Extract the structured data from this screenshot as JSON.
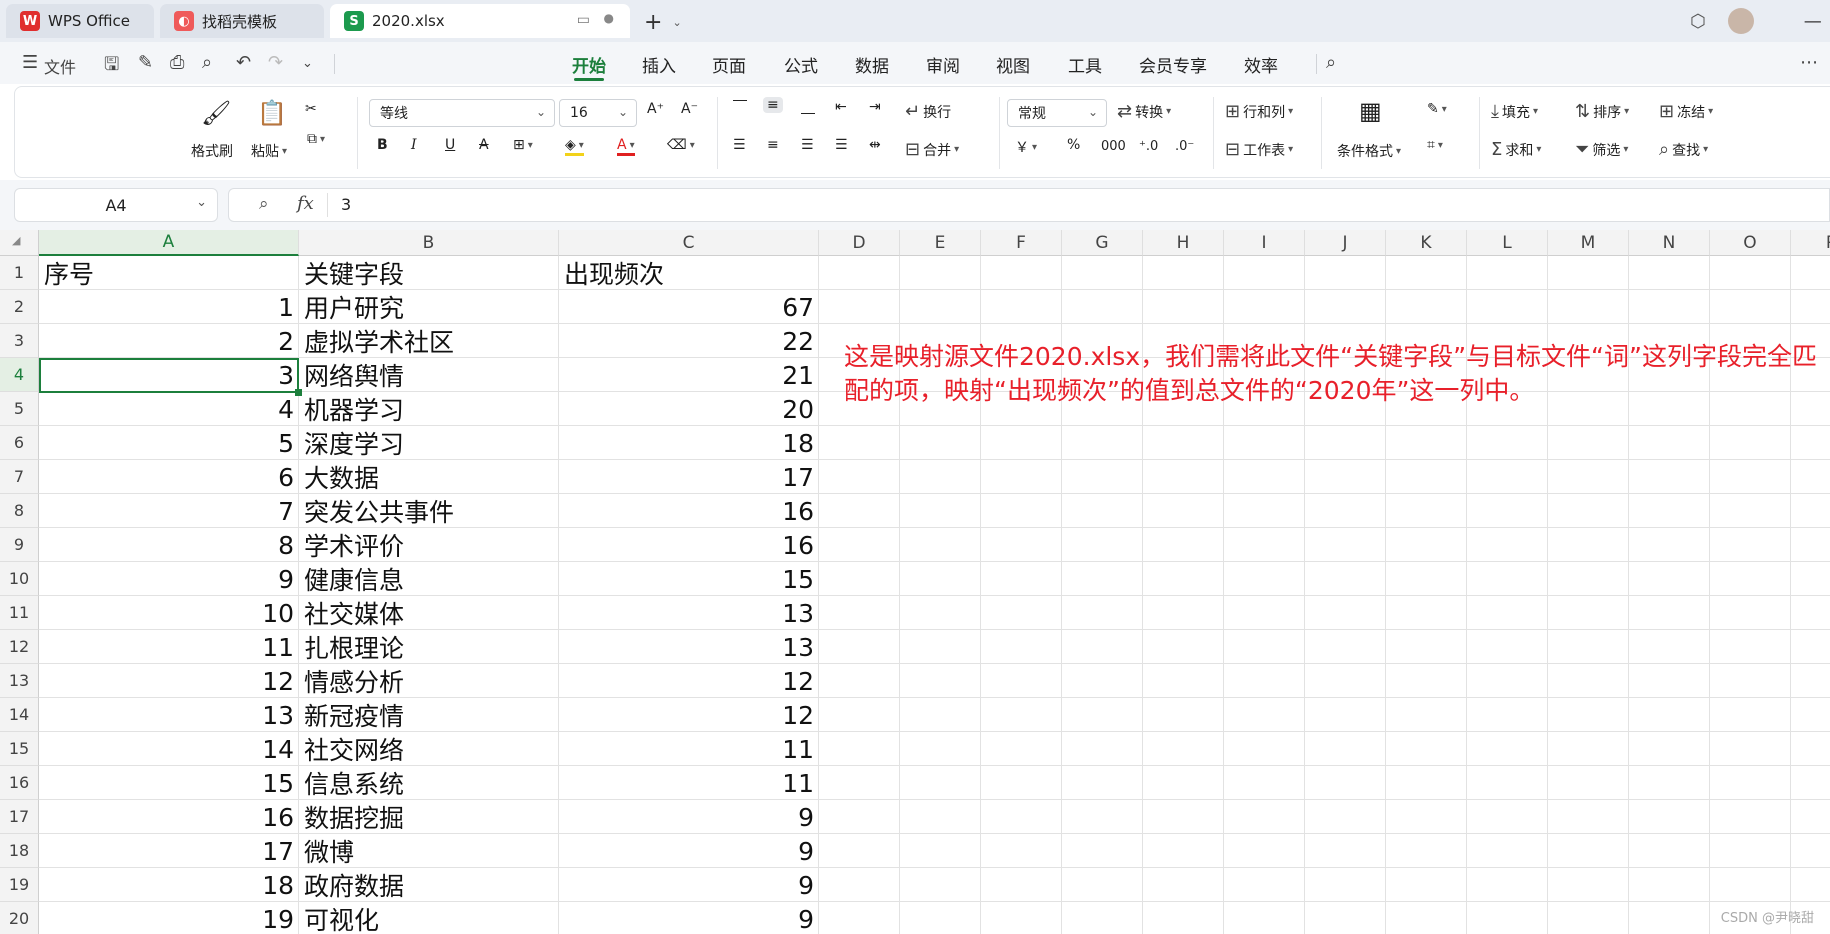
{
  "tabs": [
    {
      "label": "WPS Office",
      "icon": "wps-logo-icon",
      "active": false
    },
    {
      "label": "找稻壳模板",
      "icon": "docer-logo-icon",
      "active": false
    },
    {
      "label": "2020.xlsx",
      "icon": "spreadsheet-file-icon",
      "active": true
    }
  ],
  "menubar": {
    "file_label": "文件",
    "items": [
      "开始",
      "插入",
      "页面",
      "公式",
      "数据",
      "审阅",
      "视图",
      "工具",
      "会员专享",
      "效率"
    ],
    "active": "开始"
  },
  "ribbon": {
    "format_painter": "格式刷",
    "paste": "粘贴",
    "font_name": "等线",
    "font_size": "16",
    "wrap_text": "换行",
    "merge": "合并",
    "number_format": "常规",
    "convert": "转换",
    "rows_cols": "行和列",
    "worksheet": "工作表",
    "conditional_format": "条件格式",
    "fill": "填充",
    "sort": "排序",
    "freeze": "冻结",
    "sum": "求和",
    "filter": "筛选",
    "find": "查找",
    "currency_symbol": "￥",
    "percent_symbol": "%"
  },
  "formula_bar": {
    "name_box": "A4",
    "fx_label": "fx",
    "value": "3"
  },
  "grid": {
    "columns": [
      "A",
      "B",
      "C",
      "D",
      "E",
      "F",
      "G",
      "H",
      "I",
      "J",
      "K",
      "L",
      "M",
      "N",
      "O",
      "P"
    ],
    "selected_column": "A",
    "selected_row": 4,
    "row_numbers": [
      "1",
      "2",
      "3",
      "4",
      "5",
      "6",
      "7",
      "8",
      "9",
      "10",
      "11",
      "12",
      "13",
      "14",
      "15",
      "16",
      "17",
      "18",
      "19",
      "20"
    ],
    "header_row": [
      "序号",
      "关键字段",
      "出现频次"
    ],
    "rows": [
      [
        "1",
        "用户研究",
        "67"
      ],
      [
        "2",
        "虚拟学术社区",
        "22"
      ],
      [
        "3",
        "网络舆情",
        "21"
      ],
      [
        "4",
        "机器学习",
        "20"
      ],
      [
        "5",
        "深度学习",
        "18"
      ],
      [
        "6",
        "大数据",
        "17"
      ],
      [
        "7",
        "突发公共事件",
        "16"
      ],
      [
        "8",
        "学术评价",
        "16"
      ],
      [
        "9",
        "健康信息",
        "15"
      ],
      [
        "10",
        "社交媒体",
        "13"
      ],
      [
        "11",
        "扎根理论",
        "13"
      ],
      [
        "12",
        "情感分析",
        "12"
      ],
      [
        "13",
        "新冠疫情",
        "12"
      ],
      [
        "14",
        "社交网络",
        "11"
      ],
      [
        "15",
        "信息系统",
        "11"
      ],
      [
        "16",
        "数据挖掘",
        "9"
      ],
      [
        "17",
        "微博",
        "9"
      ],
      [
        "18",
        "政府数据",
        "9"
      ],
      [
        "19",
        "可视化",
        "9"
      ]
    ]
  },
  "annotation": "这是映射源文件2020.xlsx，我们需将此文件“关键字段”与目标文件“词”这列字段完全匹配的项，映射“出现频次”的值到总文件的“2020年”这一列中。",
  "watermark": "CSDN @尹晓甜",
  "colors": {
    "accent": "#1c7f3c",
    "annotation": "#e8202a"
  }
}
